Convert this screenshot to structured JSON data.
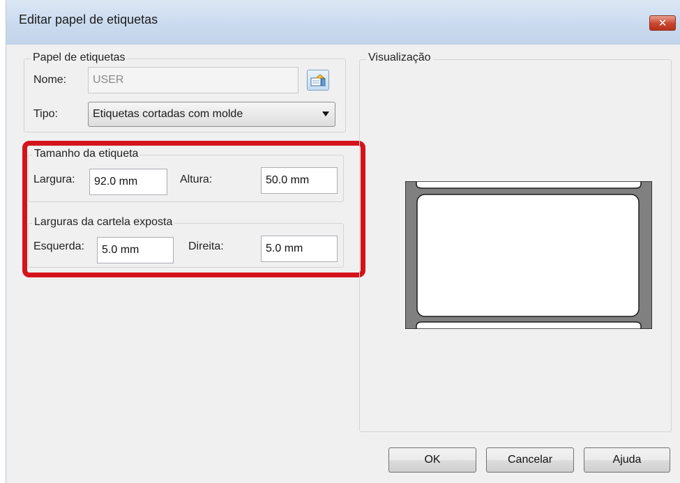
{
  "window": {
    "title": "Editar papel de etiquetas"
  },
  "paper_group": {
    "legend": "Papel de etiquetas",
    "name_label": "Nome:",
    "name_value": "USER",
    "type_label": "Tipo:",
    "type_value": "Etiquetas cortadas com molde"
  },
  "size_group": {
    "legend": "Tamanho da etiqueta",
    "width_label": "Largura:",
    "width_value": "92.0 mm",
    "height_label": "Altura:",
    "height_value": "50.0 mm"
  },
  "margins_group": {
    "legend": "Larguras da cartela exposta",
    "left_label": "Esquerda:",
    "left_value": "5.0 mm",
    "right_label": "Direita:",
    "right_value": "5.0 mm"
  },
  "preview": {
    "legend": "Visualização"
  },
  "buttons": {
    "ok": "OK",
    "cancel": "Cancelar",
    "help": "Ajuda"
  },
  "colors": {
    "highlight": "#d4141c",
    "liner": "#808080"
  }
}
